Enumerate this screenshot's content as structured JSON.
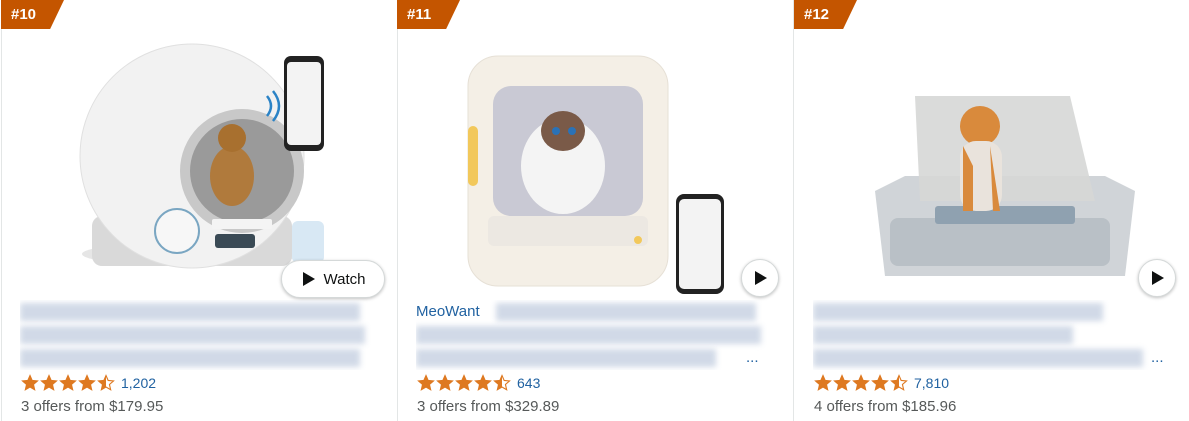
{
  "products": [
    {
      "rank": "#10",
      "brand": "",
      "title_tail": "",
      "watch_label": "Watch",
      "rating": 4.5,
      "rating_count": "1,202",
      "offers": "3 offers from $179.95"
    },
    {
      "rank": "#11",
      "brand": "MeoWant",
      "title_tail": "...",
      "watch_label": "",
      "rating": 4.5,
      "rating_count": "643",
      "offers": "3 offers from $329.89"
    },
    {
      "rank": "#12",
      "brand": "",
      "title_tail": "...",
      "watch_label": "",
      "rating": 4.5,
      "rating_count": "7,810",
      "offers": "4 offers from $185.96"
    }
  ],
  "colors": {
    "badge": "#c45500",
    "star": "#de7921",
    "link": "#2162a1"
  }
}
